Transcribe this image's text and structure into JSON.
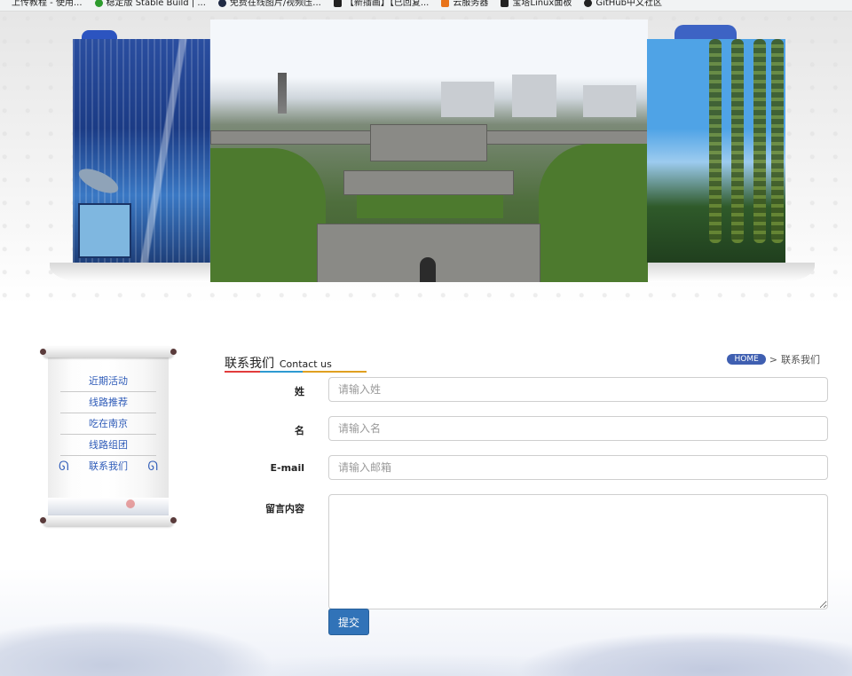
{
  "bookmarks": [
    {
      "label": "上传教程 - 使用...",
      "color": "#ffffff"
    },
    {
      "label": "稳定版 Stable Build | ...",
      "color": "#2e9b2e"
    },
    {
      "label": "免费在线图片/视频压...",
      "color": "#1f2a44"
    },
    {
      "label": "【新插画】【已回复...",
      "color": "#222222"
    },
    {
      "label": "云服务器",
      "color": "#e8731a"
    },
    {
      "label": "宝塔Linux面板",
      "color": "#222222"
    },
    {
      "label": "GitHub中文社区",
      "color": "#222222"
    }
  ],
  "sidebar": {
    "items": [
      {
        "label": "近期活动"
      },
      {
        "label": "线路推荐"
      },
      {
        "label": "吃在南京"
      },
      {
        "label": "线路组团"
      },
      {
        "label": "联系我们",
        "active": true
      }
    ]
  },
  "content": {
    "title_cn": "联系我们",
    "title_en": "Contact us",
    "breadcrumb": {
      "home": "HOME",
      "separator": ">",
      "current": "联系我们"
    }
  },
  "form": {
    "last_name": {
      "label": "姓",
      "placeholder": "请输入姓"
    },
    "first_name": {
      "label": "名",
      "placeholder": "请输入名"
    },
    "email": {
      "label": "E-mail",
      "placeholder": "请输入邮箱"
    },
    "message": {
      "label": "留言内容",
      "placeholder": ""
    },
    "submit_label": "提交"
  },
  "colors": {
    "accent_blue": "#3173b8",
    "menu_link": "#2e5bb8",
    "breadcrumb_home": "#3f5fb1"
  }
}
